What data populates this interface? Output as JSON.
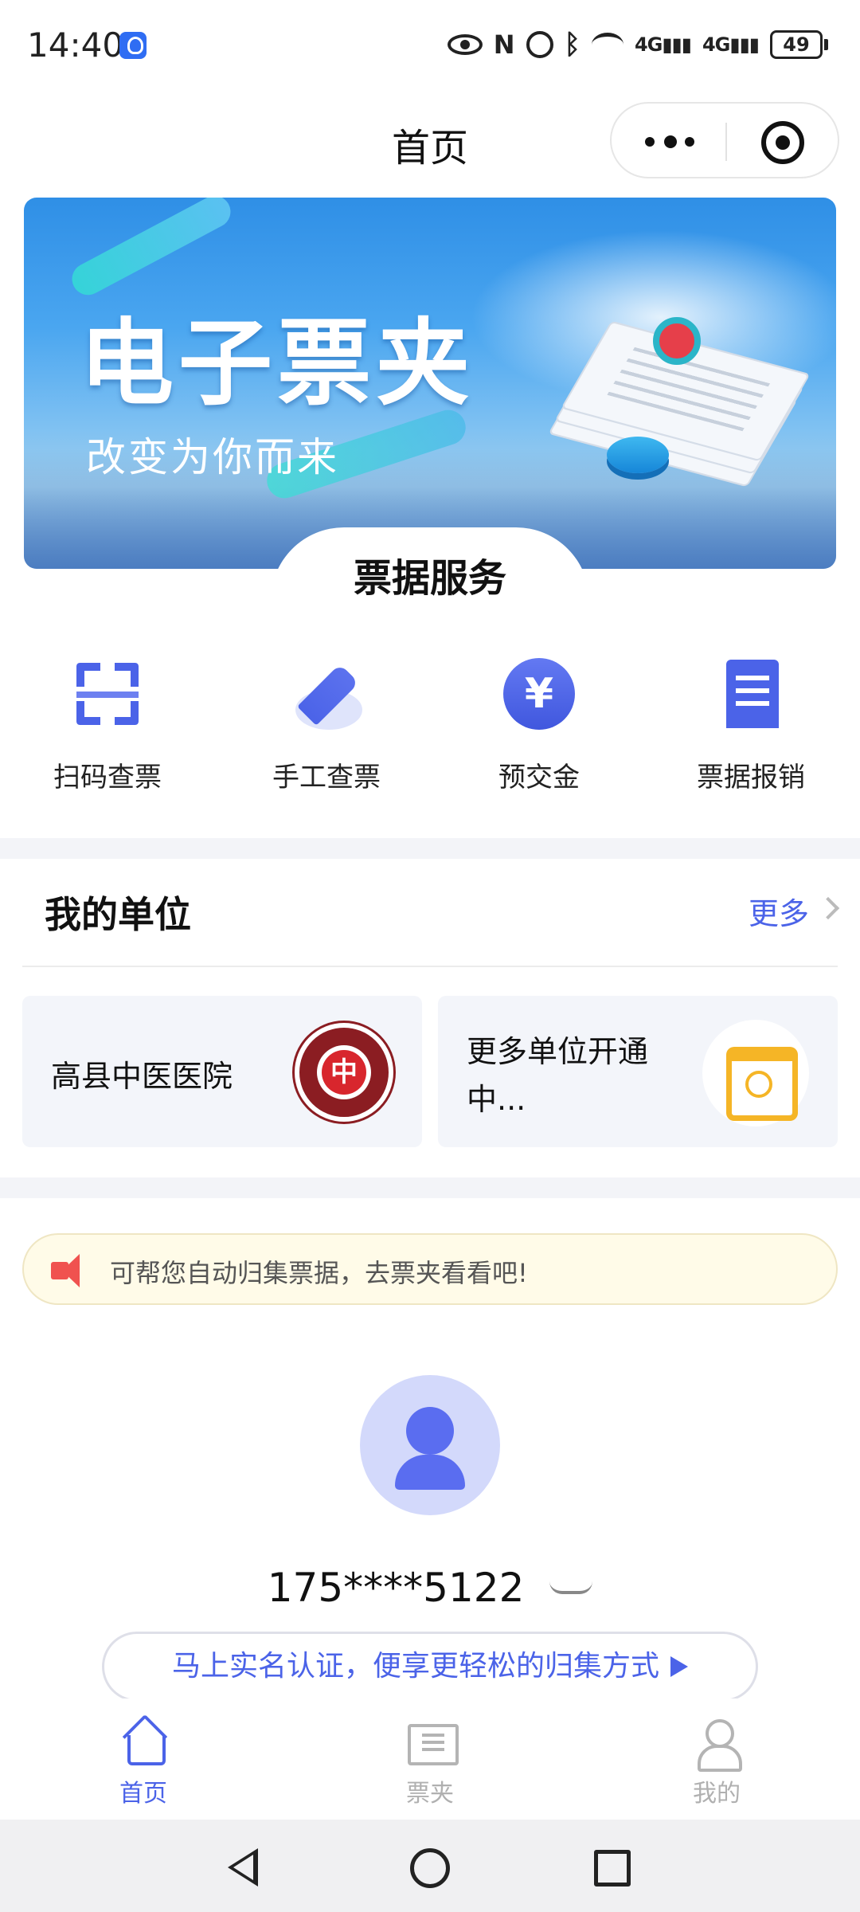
{
  "status_bar": {
    "time": "14:40",
    "network_1": "4G",
    "network_2": "4G",
    "battery": "49"
  },
  "header": {
    "title": "首页"
  },
  "banner": {
    "title": "电子票夹",
    "subtitle": "改变为你而来"
  },
  "services": {
    "section_title": "票据服务",
    "items": [
      {
        "label": "扫码查票",
        "icon": "qr-scan-icon"
      },
      {
        "label": "手工查票",
        "icon": "pen-icon"
      },
      {
        "label": "预交金",
        "icon": "yen-icon"
      },
      {
        "label": "票据报销",
        "icon": "receipt-icon"
      }
    ]
  },
  "units": {
    "title": "我的单位",
    "more": "更多",
    "cards": [
      {
        "name": "高县中医医院",
        "icon": "hospital-logo"
      },
      {
        "name": "更多单位开通中...",
        "icon": "calendar-icon"
      }
    ]
  },
  "notice": {
    "text": "可帮您自动归集票据，去票夹看看吧!"
  },
  "profile": {
    "phone": "175****5122",
    "realname_button": "马上实名认证，便享更轻松的归集方式"
  },
  "tabbar": {
    "items": [
      {
        "label": "首页",
        "icon": "home-icon",
        "active": true
      },
      {
        "label": "票夹",
        "icon": "ticket-folder-icon",
        "active": false
      },
      {
        "label": "我的",
        "icon": "user-icon",
        "active": false
      }
    ]
  },
  "colors": {
    "accent": "#4b63e8",
    "notice_bg": "#fffbe8",
    "alert_red": "#f0524f"
  }
}
